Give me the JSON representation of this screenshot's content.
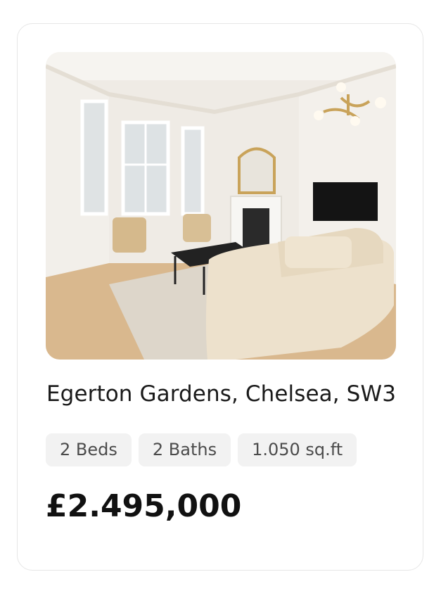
{
  "listing": {
    "title": "Egerton Gardens, Chelsea, SW3",
    "features": [
      {
        "label": "2 Beds"
      },
      {
        "label": "2 Baths"
      },
      {
        "label": "1.050 sq.ft"
      }
    ],
    "price": "£2.495,000"
  },
  "colors": {
    "text_primary": "#1a1a1a",
    "tag_background": "#f2f2f2",
    "tag_text": "#4b4b4b",
    "card_border": "#e6e6e6"
  }
}
